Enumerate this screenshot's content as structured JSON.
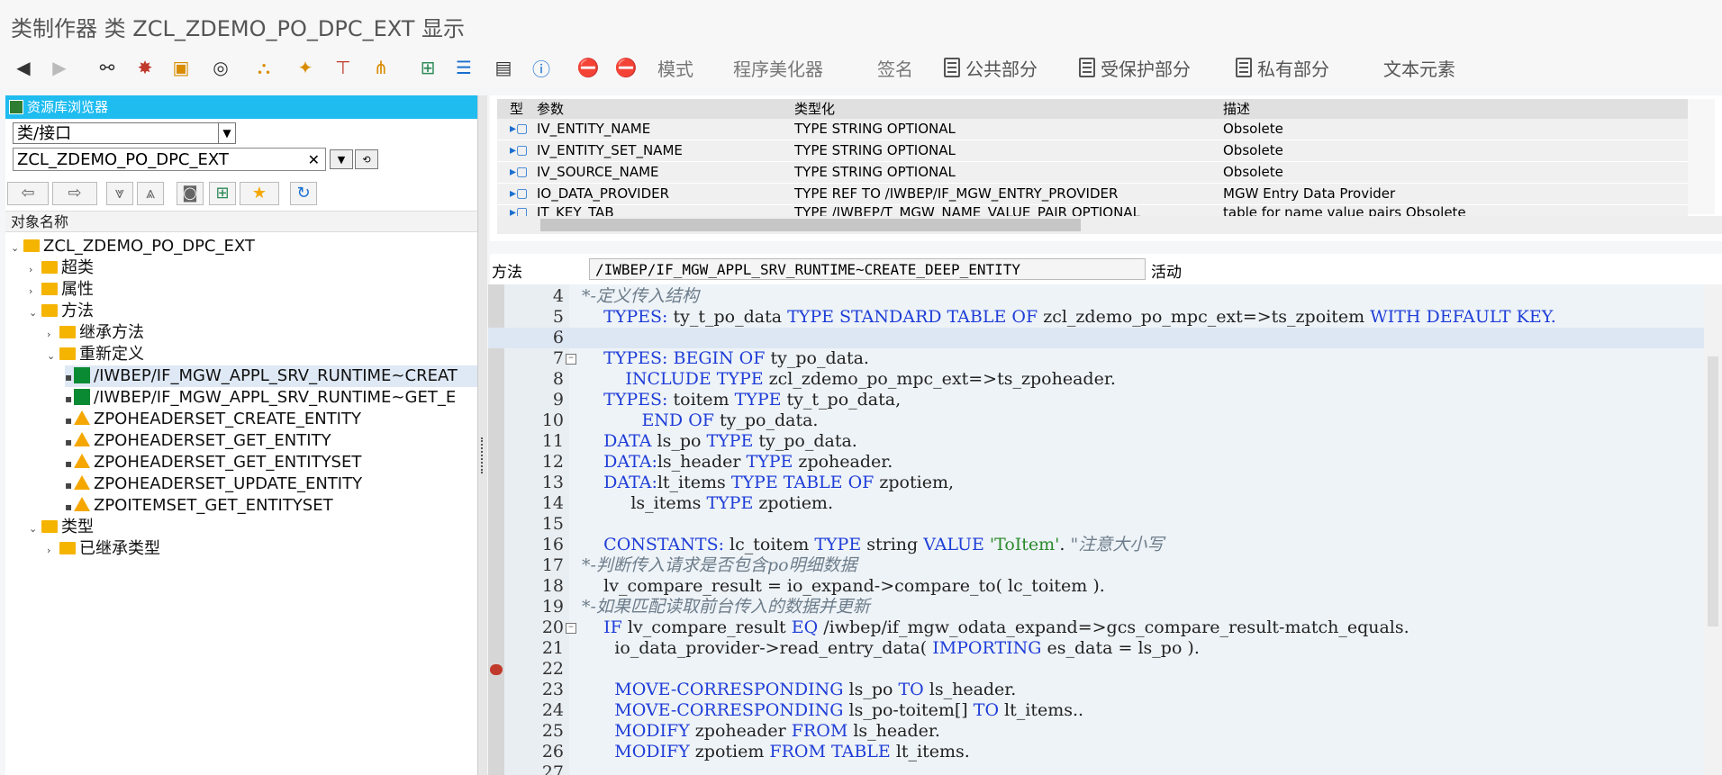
{
  "title": "类制作器 类 ZCL_ZDEMO_PO_DPC_EXT 显示",
  "toolbar": {
    "text_buttons": [
      {
        "label": "模式",
        "left": 0
      },
      {
        "label": "程序美化器"
      },
      {
        "label": "签名"
      },
      {
        "label": "公共部分"
      },
      {
        "label": "受保护部分"
      },
      {
        "label": "私有部分"
      },
      {
        "label": "文本元素"
      }
    ]
  },
  "left_panel": {
    "header": "资源库浏览器",
    "object_type": "类/接口",
    "object_name": "ZCL_ZDEMO_PO_DPC_EXT",
    "column_header": "对象名称",
    "tree": [
      {
        "label": "ZCL_ZDEMO_PO_DPC_EXT",
        "icon": "folder-icon",
        "arrow": "down"
      },
      {
        "label": "超类",
        "icon": "folder-icon",
        "arrow": "right"
      },
      {
        "label": "属性",
        "icon": "folder-icon",
        "arrow": "right"
      },
      {
        "label": "方法",
        "icon": "folder-open-icon",
        "arrow": "down"
      },
      {
        "label": "继承方法",
        "icon": "folder-icon",
        "arrow": "right"
      },
      {
        "label": "重新定义",
        "icon": "folder-open-icon",
        "arrow": "down"
      },
      {
        "label": "/IWBEP/IF_MGW_APPL_SRV_RUNTIME~CREAT",
        "icon": "green-method-icon"
      },
      {
        "label": "/IWBEP/IF_MGW_APPL_SRV_RUNTIME~GET_E",
        "icon": "green-method-icon"
      },
      {
        "label": "ZPOHEADERSET_CREATE_ENTITY",
        "icon": "warning-triangle-icon"
      },
      {
        "label": "ZPOHEADERSET_GET_ENTITY",
        "icon": "warning-triangle-icon"
      },
      {
        "label": "ZPOHEADERSET_GET_ENTITYSET",
        "icon": "warning-triangle-icon"
      },
      {
        "label": "ZPOHEADERSET_UPDATE_ENTITY",
        "icon": "warning-triangle-icon"
      },
      {
        "label": "ZPOITEMSET_GET_ENTITYSET",
        "icon": "warning-triangle-icon"
      },
      {
        "label": "类型",
        "icon": "folder-open-icon",
        "arrow": "down"
      },
      {
        "label": "已继承类型",
        "icon": "folder-icon",
        "arrow": "right"
      }
    ]
  },
  "params": {
    "headers": {
      "type": "型",
      "param": "参数",
      "typing": "类型化",
      "desc": "描述"
    },
    "rows": [
      {
        "param": "IV_ENTITY_NAME",
        "typing": "TYPE STRING OPTIONAL",
        "desc": "Obsolete"
      },
      {
        "param": "IV_ENTITY_SET_NAME",
        "typing": "TYPE STRING OPTIONAL",
        "desc": "Obsolete"
      },
      {
        "param": "IV_SOURCE_NAME",
        "typing": "TYPE STRING OPTIONAL",
        "desc": "Obsolete"
      },
      {
        "param": "IO_DATA_PROVIDER",
        "typing": "TYPE REF TO /IWBEP/IF_MGW_ENTRY_PROVIDER",
        "desc": "MGW Entry Data Provider"
      },
      {
        "param": "IT_KEY_TAB",
        "typing": "TYPE /IWBEP/T_MGW_NAME_VALUE_PAIR OPTIONAL",
        "desc": "table for name value pairs Obsolete"
      }
    ]
  },
  "method": {
    "label": "方法",
    "name": "/IWBEP/IF_MGW_APPL_SRV_RUNTIME~CREATE_DEEP_ENTITY",
    "status": "活动"
  },
  "editor": {
    "lines": [
      {
        "n": "4",
        "html": "<span class=\"cm\">*-定义传入结构</span>"
      },
      {
        "n": "5",
        "html": "    <span class=\"kw\">TYPES:</span> ty_t_po_data <span class=\"kw\">TYPE STANDARD TABLE OF</span> zcl_zdemo_po_mpc_ext=&gt;ts_zpoitem <span class=\"kw\">WITH DEFAULT KEY.</span>"
      },
      {
        "n": "6",
        "html": "",
        "hl": true
      },
      {
        "n": "7",
        "html": "    <span class=\"kw\">TYPES: BEGIN OF</span> ty_po_data.",
        "fold": true
      },
      {
        "n": "8",
        "html": "        <span class=\"kw\">INCLUDE TYPE</span> zcl_zdemo_po_mpc_ext=&gt;ts_zpoheader."
      },
      {
        "n": "9",
        "html": "    <span class=\"kw\">TYPES:</span> toitem <span class=\"kw\">TYPE</span> ty_t_po_data,"
      },
      {
        "n": "10",
        "html": "           <span class=\"kw\">END OF</span> ty_po_data."
      },
      {
        "n": "11",
        "html": "    <span class=\"kw\">DATA</span> ls_po <span class=\"kw\">TYPE</span> ty_po_data."
      },
      {
        "n": "12",
        "html": "    <span class=\"kw\">DATA:</span>ls_header <span class=\"kw\">TYPE</span> zpoheader."
      },
      {
        "n": "13",
        "html": "    <span class=\"kw\">DATA:</span>lt_items <span class=\"kw\">TYPE TABLE OF</span> zpotiem,"
      },
      {
        "n": "14",
        "html": "         ls_items <span class=\"kw\">TYPE</span> zpotiem."
      },
      {
        "n": "15",
        "html": ""
      },
      {
        "n": "16",
        "html": "    <span class=\"kw\">CONSTANTS:</span> lc_toitem <span class=\"kw\">TYPE</span> string <span class=\"kw\">VALUE</span> <span class=\"str\">'ToItem'</span>. <span class=\"cm\">\"注意大小写</span>"
      },
      {
        "n": "17",
        "html": "<span class=\"cm\">*-判断传入请求是否包含po明细数据</span>"
      },
      {
        "n": "18",
        "html": "    lv_compare_result = io_expand-&gt;compare_to( lc_toitem )."
      },
      {
        "n": "19",
        "html": "<span class=\"cm\">*-如果匹配读取前台传入的数据并更新</span>"
      },
      {
        "n": "20",
        "html": "    <span class=\"kw\">IF</span> lv_compare_result <span class=\"kw\">EQ</span> /iwbep/if_mgw_odata_expand=&gt;gcs_compare_result-match_equals.",
        "fold": true
      },
      {
        "n": "21",
        "html": "      io_data_provider-&gt;read_entry_data( <span class=\"kw\">IMPORTING</span> es_data = ls_po )."
      },
      {
        "n": "22",
        "html": "",
        "bp": true
      },
      {
        "n": "23",
        "html": "      <span class=\"kw\">MOVE-CORRESPONDING</span> ls_po <span class=\"kw\">TO</span> ls_header."
      },
      {
        "n": "24",
        "html": "      <span class=\"kw\">MOVE-CORRESPONDING</span> ls_po-toitem[] <span class=\"kw\">TO</span> lt_items.."
      },
      {
        "n": "25",
        "html": "      <span class=\"kw\">MODIFY</span> zpoheader <span class=\"kw\">FROM</span> ls_header."
      },
      {
        "n": "26",
        "html": "      <span class=\"kw\">MODIFY</span> zpotiem <span class=\"kw\">FROM TABLE</span> lt_items."
      },
      {
        "n": "27",
        "html": ""
      }
    ]
  }
}
